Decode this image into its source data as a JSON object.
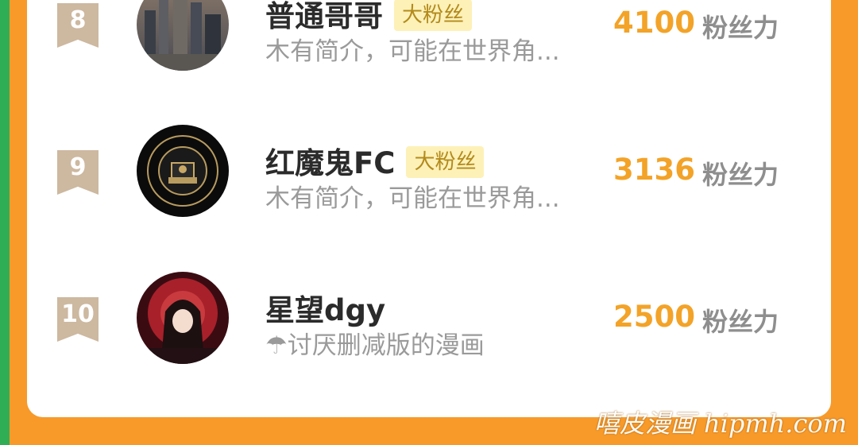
{
  "unit_label": "粉丝力",
  "watermark": "嘻皮漫画 hipmh.com",
  "rows": [
    {
      "rank": "8",
      "name": "普通哥哥",
      "badge": "大粉丝",
      "bio": "木有简介，可能在世界角...",
      "score": "4100",
      "avatar": "city-skyline-avatar"
    },
    {
      "rank": "9",
      "name": "红魔鬼FC",
      "badge": "大粉丝",
      "bio": "木有简介，可能在世界角...",
      "score": "3136",
      "avatar": "manchester-united-crest-avatar"
    },
    {
      "rank": "10",
      "name": "星望dgy",
      "badge": "",
      "bio": "☂讨厌删减版的漫画",
      "score": "2500",
      "avatar": "anime-girl-red-moon-avatar"
    }
  ]
}
